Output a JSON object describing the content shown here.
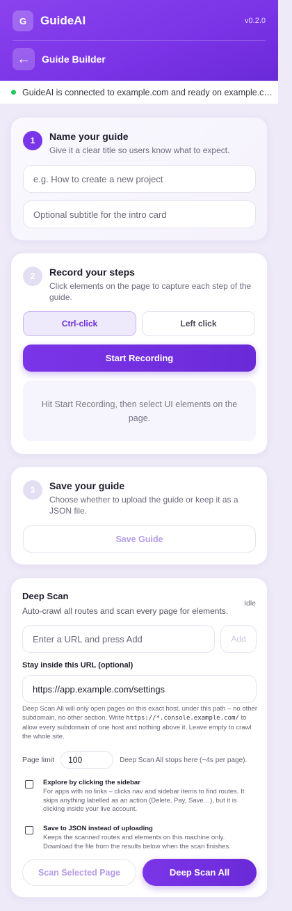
{
  "header": {
    "logo_letter": "G",
    "app_name": "GuideAI",
    "version": "v0.2.0",
    "back_glyph": "←",
    "page_title": "Guide Builder",
    "accent": "#7b35e8"
  },
  "status": {
    "text": "GuideAI is connected to example.com and ready on example.com",
    "dot_color": "#22c55e"
  },
  "step1": {
    "number": "1",
    "title": "Name your guide",
    "description": "Give it a clear title so users know what to expect.",
    "title_placeholder": "e.g. How to create a new project",
    "title_value": "",
    "subtitle_placeholder": "Optional subtitle for the intro card",
    "subtitle_value": ""
  },
  "step2": {
    "number": "2",
    "title": "Record your steps",
    "description": "Click elements on the page to capture each step of the guide.",
    "mode_options": [
      "Ctrl-click",
      "Left click"
    ],
    "selected_mode": "Ctrl-click",
    "start_label": "Start Recording",
    "hint": "Hit Start Recording, then select UI elements on the page."
  },
  "step3": {
    "number": "3",
    "title": "Save your guide",
    "description": "Choose whether to upload the guide or keep it as a JSON file.",
    "save_label": "Save Guide"
  },
  "deep_scan": {
    "title": "Deep Scan",
    "status": "Idle",
    "description": "Auto-crawl all routes and scan every page for elements.",
    "url_placeholder": "Enter a URL and press Add",
    "url_value": "",
    "add_label": "Add",
    "scope_label": "Stay inside this URL (optional)",
    "scope_value": "https://app.example.com/settings",
    "scope_note_1": "Deep Scan All will only open pages on this exact host, under this path – no other subdomain, no other section. Write",
    "scope_note_code": "https://*.console.example.com/",
    "scope_note_2": "to allow every subdomain of one host and nothing above it. Leave empty to crawl the whole site.",
    "page_limit_label": "Page limit",
    "page_limit_value": "100",
    "page_limit_hint": "Deep Scan All stops here (~4s per page).",
    "options": [
      {
        "title": "Explore by clicking the sidebar",
        "description": "For apps with no links – clicks nav and sidebar items to find routes. It skips anything labelled as an action (Delete, Pay, Save…), but it is clicking inside your live account.",
        "checked": false
      },
      {
        "title": "Save to JSON instead of uploading",
        "description": "Keeps the scanned routes and elements on this machine only. Download the file from the results below when the scan finishes.",
        "checked": false
      }
    ],
    "scan_selected_label": "Scan Selected Page",
    "scan_all_label": "Deep Scan All"
  }
}
